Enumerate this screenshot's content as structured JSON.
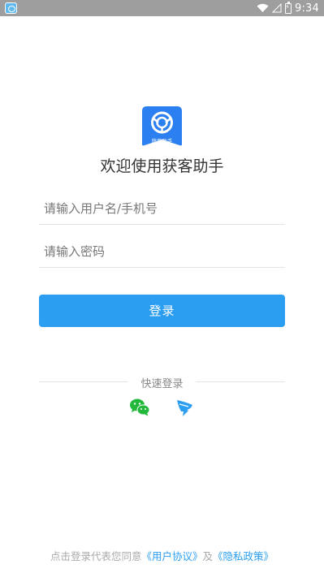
{
  "status_bar": {
    "time": "9:34",
    "icons": [
      "app-notification-icon",
      "wifi-icon",
      "signal-icon",
      "battery-charging-icon"
    ]
  },
  "logo": {
    "icon": "app-logo-icon",
    "text": "获客助手",
    "color": "#2b7ff0"
  },
  "welcome": "欢迎使用获客助手",
  "form": {
    "username_placeholder": "请输入用户名/手机号",
    "password_placeholder": "请输入密码",
    "login_label": "登录"
  },
  "quick_login": {
    "label": "快速登录",
    "providers": [
      {
        "name": "wechat",
        "icon": "wechat-icon",
        "color": "#22b83a"
      },
      {
        "name": "dingtalk",
        "icon": "dingtalk-icon",
        "color": "#2b9ef2"
      }
    ]
  },
  "agreement": {
    "prefix": "点击登录代表您同意",
    "user_agreement": "《用户协议》",
    "connector": "及",
    "privacy_policy": "《隐私政策》"
  },
  "colors": {
    "accent": "#2b9ef2",
    "status_bar": "#9e9e9e"
  }
}
